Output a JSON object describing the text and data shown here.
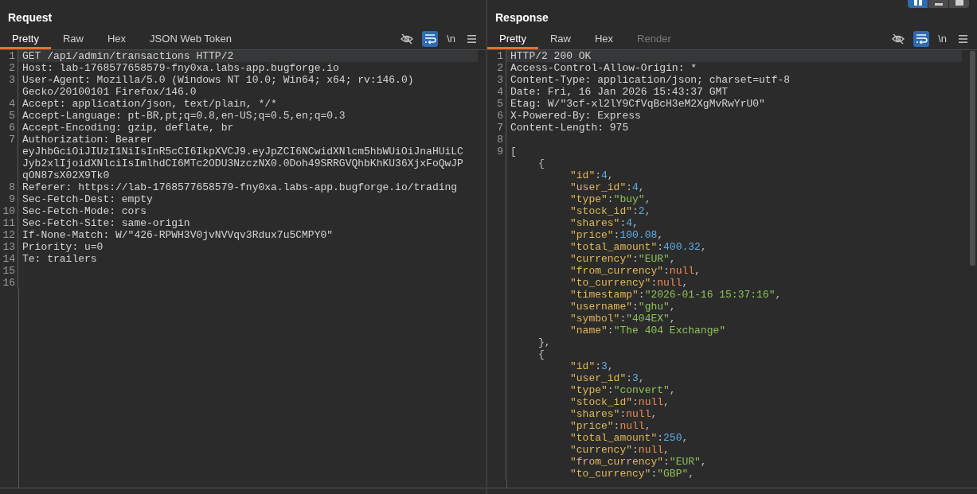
{
  "layout_buttons": [
    {
      "selected": true
    },
    {
      "selected": false
    },
    {
      "selected": false
    }
  ],
  "panes": [
    {
      "title": "Request",
      "tabs": [
        {
          "label": "Pretty",
          "selected": true,
          "disabled": false
        },
        {
          "label": "Raw",
          "selected": false,
          "disabled": false
        },
        {
          "label": "Hex",
          "selected": false,
          "disabled": false
        },
        {
          "label": "JSON Web Token",
          "selected": false,
          "disabled": false
        }
      ],
      "toolbar": {
        "hide_on": false,
        "wrap_on": true,
        "newline_label": "\\n"
      },
      "lines": [
        {
          "number": "1",
          "current": true,
          "rows": [
            "GET /api/admin/transactions HTTP/2"
          ]
        },
        {
          "number": "2",
          "current": false,
          "rows": [
            "Host: lab-1768577658579-fny0xa.labs-app.bugforge.io"
          ]
        },
        {
          "number": "3",
          "current": false,
          "rows": [
            "User-Agent: Mozilla/5.0 (Windows NT 10.0; Win64; x64; rv:146.0)",
            "Gecko/20100101 Firefox/146.0"
          ]
        },
        {
          "number": "4",
          "current": false,
          "rows": [
            "Accept: application/json, text/plain, */*"
          ]
        },
        {
          "number": "5",
          "current": false,
          "rows": [
            "Accept-Language: pt-BR,pt;q=0.8,en-US;q=0.5,en;q=0.3"
          ]
        },
        {
          "number": "6",
          "current": false,
          "rows": [
            "Accept-Encoding: gzip, deflate, br"
          ]
        },
        {
          "number": "7",
          "current": false,
          "rows": [
            "Authorization: Bearer",
            "eyJhbGciOiJIUzI1NiIsInR5cCI6IkpXVCJ9.eyJpZCI6NCwidXNlcm5hbWUiOiJnaHUiLC",
            "Jyb2xlIjoidXNlciIsImlhdCI6MTc2ODU3NzczNX0.0Doh49SRRGVQhbKhKU36XjxFoQwJP",
            "qON87sX02X9Tk0"
          ]
        },
        {
          "number": "8",
          "current": false,
          "rows": [
            "Referer: https://lab-1768577658579-fny0xa.labs-app.bugforge.io/trading"
          ]
        },
        {
          "number": "9",
          "current": false,
          "rows": [
            "Sec-Fetch-Dest: empty"
          ]
        },
        {
          "number": "10",
          "current": false,
          "rows": [
            "Sec-Fetch-Mode: cors"
          ]
        },
        {
          "number": "11",
          "current": false,
          "rows": [
            "Sec-Fetch-Site: same-origin"
          ]
        },
        {
          "number": "12",
          "current": false,
          "rows": [
            "If-None-Match: W/\"426-RPWH3V0jvNVVqv3Rdux7u5CMPY0\""
          ]
        },
        {
          "number": "13",
          "current": false,
          "rows": [
            "Priority: u=0"
          ]
        },
        {
          "number": "14",
          "current": false,
          "rows": [
            "Te: trailers"
          ]
        },
        {
          "number": "15",
          "current": false
        },
        {
          "number": "16",
          "current": false
        }
      ]
    },
    {
      "title": "Response",
      "tabs": [
        {
          "label": "Pretty",
          "selected": true,
          "disabled": false
        },
        {
          "label": "Raw",
          "selected": false,
          "disabled": false
        },
        {
          "label": "Hex",
          "selected": false,
          "disabled": false
        },
        {
          "label": "Render",
          "selected": false,
          "disabled": true
        }
      ],
      "toolbar": {
        "hide_on": false,
        "wrap_on": true,
        "newline_label": "\\n"
      },
      "lines": [
        {
          "number": "1",
          "current": true,
          "rows": [
            "HTTP/2 200 OK"
          ]
        },
        {
          "number": "2",
          "current": false,
          "rows": [
            "Access-Control-Allow-Origin: *"
          ]
        },
        {
          "number": "3",
          "current": false,
          "rows": [
            "Content-Type: application/json; charset=utf-8"
          ]
        },
        {
          "number": "4",
          "current": false,
          "rows": [
            "Date: Fri, 16 Jan 2026 15:43:37 GMT"
          ]
        },
        {
          "number": "5",
          "current": false,
          "rows": [
            "Etag: W/\"3cf-xl2lY9CfVqBcH3eM2XgMvRwYrU0\""
          ]
        },
        {
          "number": "6",
          "current": false,
          "rows": [
            "X-Powered-By: Express"
          ]
        },
        {
          "number": "7",
          "current": false,
          "rows": [
            "Content-Length: 975"
          ]
        },
        {
          "number": "8",
          "current": false
        }
      ],
      "body": {
        "number": "9",
        "open": "[",
        "objects": [
          {
            "open": "{",
            "close": "},",
            "fields": [
              [
                {
                  "kind": "key",
                  "text": "\"id\""
                },
                {
                  "kind": "punct",
                  "text": ":"
                },
                {
                  "kind": "number",
                  "text": "4"
                },
                {
                  "kind": "punct",
                  "text": ","
                }
              ],
              [
                {
                  "kind": "key",
                  "text": "\"user_id\""
                },
                {
                  "kind": "punct",
                  "text": ":"
                },
                {
                  "kind": "number",
                  "text": "4"
                },
                {
                  "kind": "punct",
                  "text": ","
                }
              ],
              [
                {
                  "kind": "key",
                  "text": "\"type\""
                },
                {
                  "kind": "punct",
                  "text": ":"
                },
                {
                  "kind": "string",
                  "text": "\"buy\""
                },
                {
                  "kind": "punct",
                  "text": ","
                }
              ],
              [
                {
                  "kind": "key",
                  "text": "\"stock_id\""
                },
                {
                  "kind": "punct",
                  "text": ":"
                },
                {
                  "kind": "number",
                  "text": "2"
                },
                {
                  "kind": "punct",
                  "text": ","
                }
              ],
              [
                {
                  "kind": "key",
                  "text": "\"shares\""
                },
                {
                  "kind": "punct",
                  "text": ":"
                },
                {
                  "kind": "number",
                  "text": "4"
                },
                {
                  "kind": "punct",
                  "text": ","
                }
              ],
              [
                {
                  "kind": "key",
                  "text": "\"price\""
                },
                {
                  "kind": "punct",
                  "text": ":"
                },
                {
                  "kind": "number",
                  "text": "100.08"
                },
                {
                  "kind": "punct",
                  "text": ","
                }
              ],
              [
                {
                  "kind": "key",
                  "text": "\"total_amount\""
                },
                {
                  "kind": "punct",
                  "text": ":"
                },
                {
                  "kind": "number",
                  "text": "400.32"
                },
                {
                  "kind": "punct",
                  "text": ","
                }
              ],
              [
                {
                  "kind": "key",
                  "text": "\"currency\""
                },
                {
                  "kind": "punct",
                  "text": ":"
                },
                {
                  "kind": "string",
                  "text": "\"EUR\""
                },
                {
                  "kind": "punct",
                  "text": ","
                }
              ],
              [
                {
                  "kind": "key",
                  "text": "\"from_currency\""
                },
                {
                  "kind": "punct",
                  "text": ":"
                },
                {
                  "kind": "null",
                  "text": "null"
                },
                {
                  "kind": "punct",
                  "text": ","
                }
              ],
              [
                {
                  "kind": "key",
                  "text": "\"to_currency\""
                },
                {
                  "kind": "punct",
                  "text": ":"
                },
                {
                  "kind": "null",
                  "text": "null"
                },
                {
                  "kind": "punct",
                  "text": ","
                }
              ],
              [
                {
                  "kind": "key",
                  "text": "\"timestamp\""
                },
                {
                  "kind": "punct",
                  "text": ":"
                },
                {
                  "kind": "string",
                  "text": "\"2026-01-16 15:37:16\""
                },
                {
                  "kind": "punct",
                  "text": ","
                }
              ],
              [
                {
                  "kind": "key",
                  "text": "\"username\""
                },
                {
                  "kind": "punct",
                  "text": ":"
                },
                {
                  "kind": "string",
                  "text": "\"ghu\""
                },
                {
                  "kind": "punct",
                  "text": ","
                }
              ],
              [
                {
                  "kind": "key",
                  "text": "\"symbol\""
                },
                {
                  "kind": "punct",
                  "text": ":"
                },
                {
                  "kind": "string",
                  "text": "\"404EX\""
                },
                {
                  "kind": "punct",
                  "text": ","
                }
              ],
              [
                {
                  "kind": "key",
                  "text": "\"name\""
                },
                {
                  "kind": "punct",
                  "text": ":"
                },
                {
                  "kind": "string",
                  "text": "\"The 404 Exchange\""
                }
              ]
            ]
          },
          {
            "open": "{",
            "fields": [
              [
                {
                  "kind": "key",
                  "text": "\"id\""
                },
                {
                  "kind": "punct",
                  "text": ":"
                },
                {
                  "kind": "number",
                  "text": "3"
                },
                {
                  "kind": "punct",
                  "text": ","
                }
              ],
              [
                {
                  "kind": "key",
                  "text": "\"user_id\""
                },
                {
                  "kind": "punct",
                  "text": ":"
                },
                {
                  "kind": "number",
                  "text": "3"
                },
                {
                  "kind": "punct",
                  "text": ","
                }
              ],
              [
                {
                  "kind": "key",
                  "text": "\"type\""
                },
                {
                  "kind": "punct",
                  "text": ":"
                },
                {
                  "kind": "string",
                  "text": "\"convert\""
                },
                {
                  "kind": "punct",
                  "text": ","
                }
              ],
              [
                {
                  "kind": "key",
                  "text": "\"stock_id\""
                },
                {
                  "kind": "punct",
                  "text": ":"
                },
                {
                  "kind": "null",
                  "text": "null"
                },
                {
                  "kind": "punct",
                  "text": ","
                }
              ],
              [
                {
                  "kind": "key",
                  "text": "\"shares\""
                },
                {
                  "kind": "punct",
                  "text": ":"
                },
                {
                  "kind": "null",
                  "text": "null"
                },
                {
                  "kind": "punct",
                  "text": ","
                }
              ],
              [
                {
                  "kind": "key",
                  "text": "\"price\""
                },
                {
                  "kind": "punct",
                  "text": ":"
                },
                {
                  "kind": "null",
                  "text": "null"
                },
                {
                  "kind": "punct",
                  "text": ","
                }
              ],
              [
                {
                  "kind": "key",
                  "text": "\"total_amount\""
                },
                {
                  "kind": "punct",
                  "text": ":"
                },
                {
                  "kind": "number",
                  "text": "250"
                },
                {
                  "kind": "punct",
                  "text": ","
                }
              ],
              [
                {
                  "kind": "key",
                  "text": "\"currency\""
                },
                {
                  "kind": "punct",
                  "text": ":"
                },
                {
                  "kind": "null",
                  "text": "null"
                },
                {
                  "kind": "punct",
                  "text": ","
                }
              ],
              [
                {
                  "kind": "key",
                  "text": "\"from_currency\""
                },
                {
                  "kind": "punct",
                  "text": ":"
                },
                {
                  "kind": "string",
                  "text": "\"EUR\""
                },
                {
                  "kind": "punct",
                  "text": ","
                }
              ],
              [
                {
                  "kind": "key",
                  "text": "\"to_currency\""
                },
                {
                  "kind": "punct",
                  "text": ":"
                },
                {
                  "kind": "string",
                  "text": "\"GBP\""
                },
                {
                  "kind": "punct",
                  "text": ","
                }
              ]
            ]
          }
        ]
      }
    }
  ]
}
